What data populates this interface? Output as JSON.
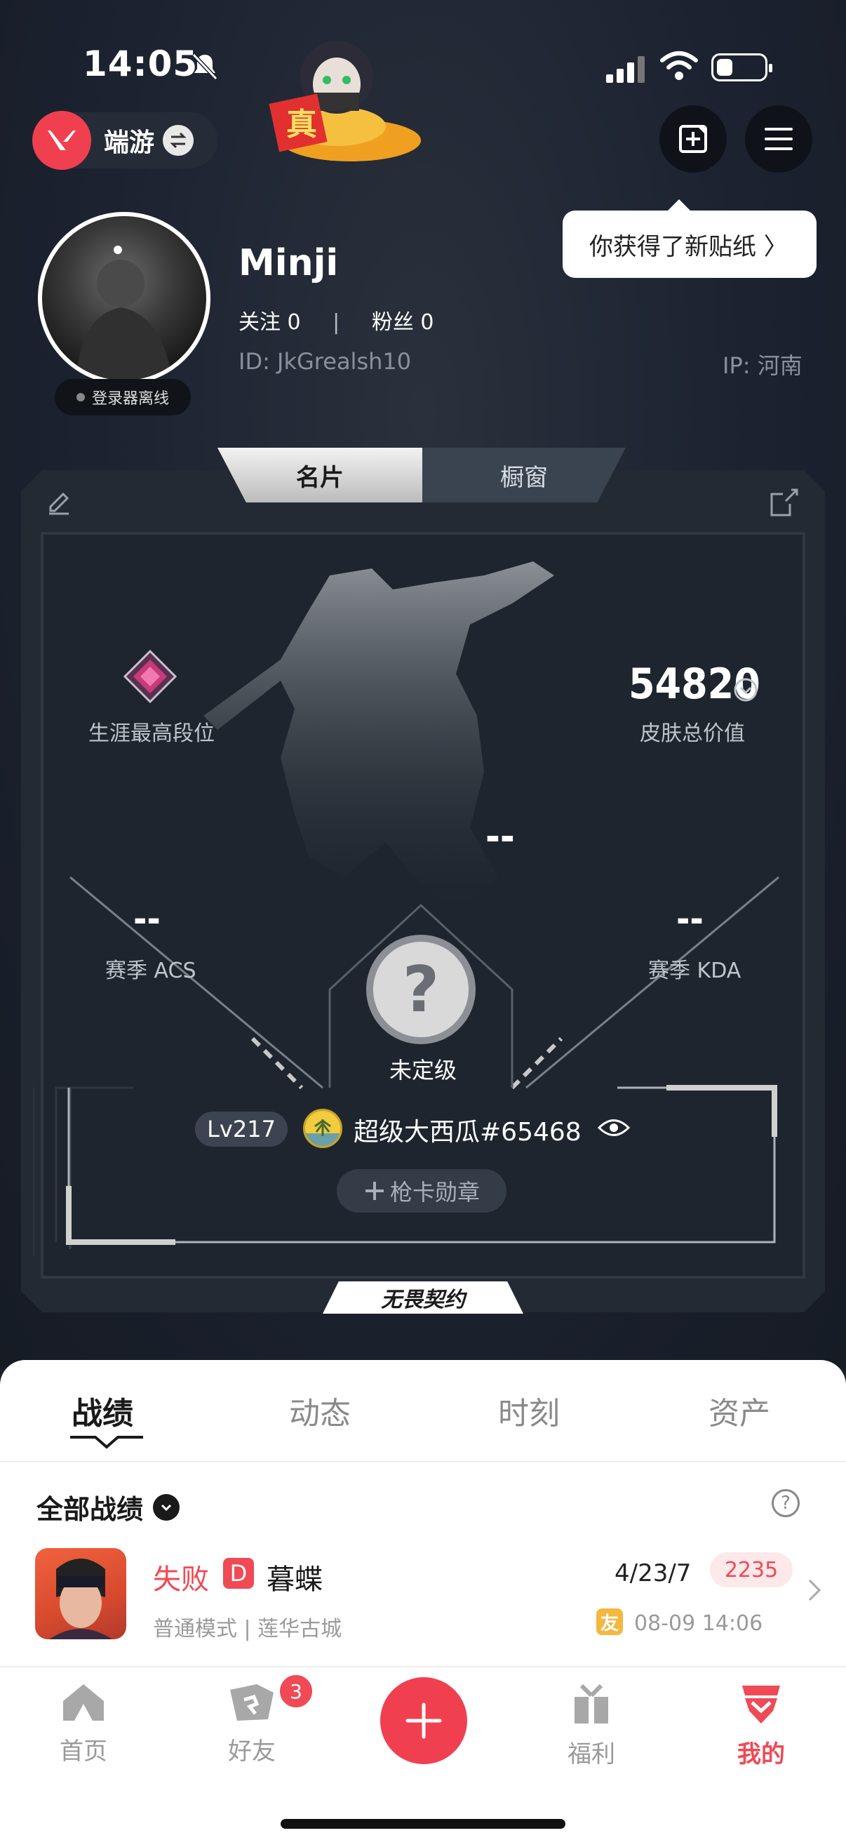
{
  "status_bar": {
    "time": "14:05"
  },
  "header": {
    "game_name": "端游",
    "toast": "你获得了新贴纸 〉"
  },
  "profile": {
    "name": "Minji",
    "following": "关注 0",
    "separator": "|",
    "fans": "粉丝 0",
    "id": "ID: JkGrealsh10",
    "ip": "IP: 河南",
    "status": "登录器离线"
  },
  "card": {
    "tabs": [
      "名片",
      "橱窗"
    ],
    "peak_rank_label": "生涯最高段位",
    "skin_value": "54820",
    "skin_value_label": "皮肤总价值",
    "center_value": "--",
    "acs_value": "--",
    "acs_label": "赛季 ACS",
    "kda_value": "--",
    "kda_label": "赛季 KDA",
    "rank_label": "未定级",
    "level": "Lv217",
    "player_tag": "超级大西瓜#65468",
    "badge_button": "枪卡勋章",
    "brand": "无畏契约"
  },
  "sheet": {
    "tabs": [
      "战绩",
      "动态",
      "时刻",
      "资产"
    ],
    "filter_label": "全部战绩",
    "help": "?",
    "match": {
      "result": "失败",
      "grade": "D",
      "map": "暮蝶",
      "mode": "普通模式 | 莲华古城",
      "kda": "4/23/7",
      "score": "2235",
      "friend_tag": "友",
      "time": "08-09 14:06"
    }
  },
  "nav": {
    "items": [
      "首页",
      "好友",
      "福利",
      "我的"
    ],
    "friends_badge": "3"
  },
  "colors": {
    "accent": "#ef4a55",
    "background": "#1b212b"
  }
}
